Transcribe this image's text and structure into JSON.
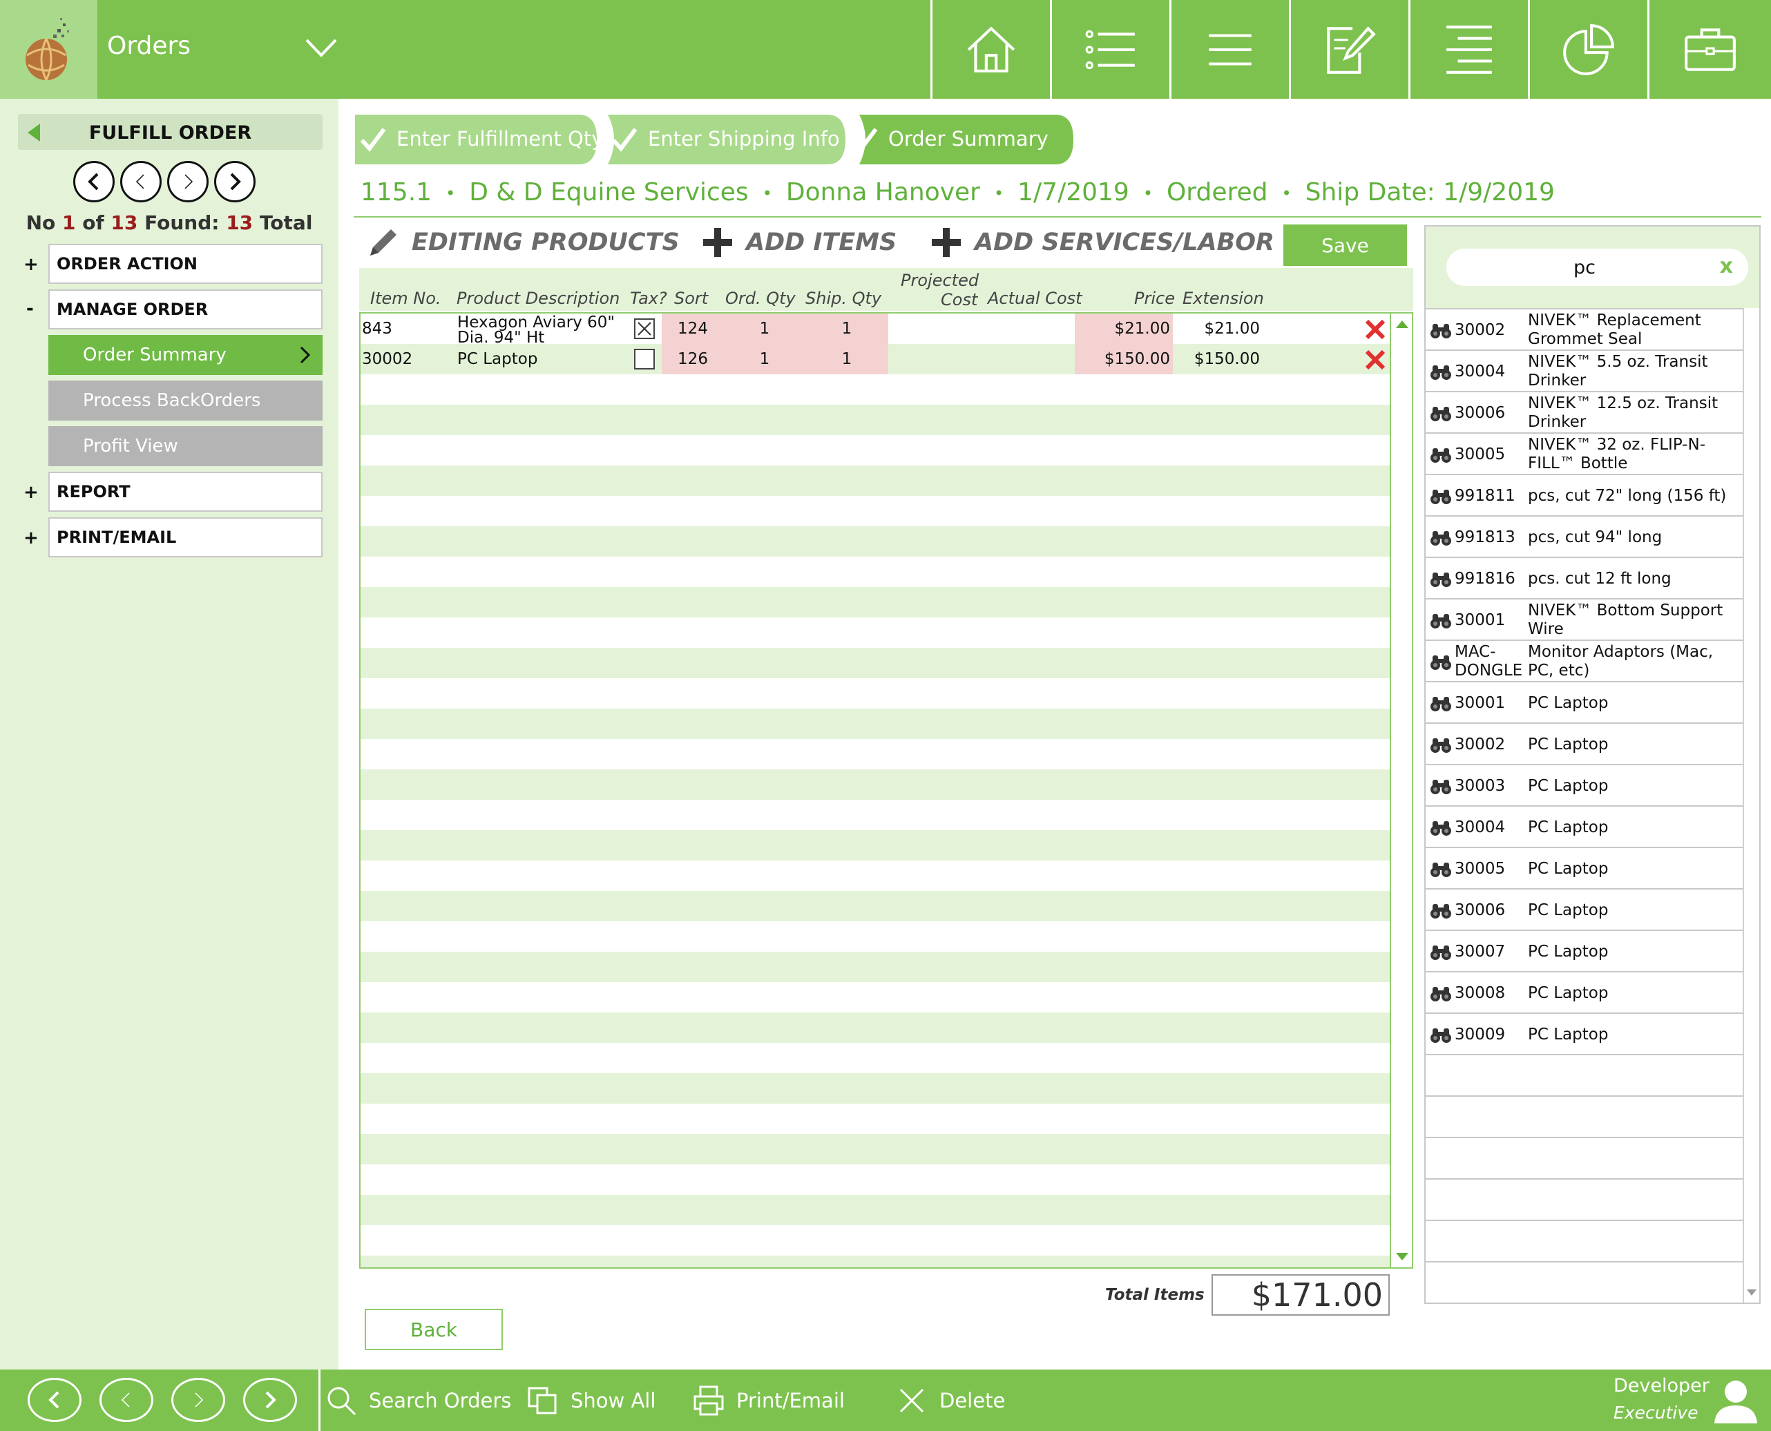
{
  "topbar": {
    "app_title": "Orders",
    "nav_icons": [
      "home-icon",
      "bullet-list-icon",
      "menu-lines-icon",
      "edit-document-icon",
      "align-lines-icon",
      "pie-chart-icon",
      "briefcase-icon"
    ]
  },
  "sidebar": {
    "header_title": "FULFILL ORDER",
    "found": {
      "prefix": "No",
      "current": "1",
      "of": "of",
      "total": "13",
      "found_label": "Found:",
      "found_count": "13",
      "total_label": "Total"
    },
    "sections": [
      {
        "sign": "+",
        "label": "ORDER ACTION"
      },
      {
        "sign": "-",
        "label": "MANAGE ORDER"
      },
      {
        "sign": "+",
        "label": "REPORT"
      },
      {
        "sign": "+",
        "label": "PRINT/EMAIL"
      }
    ],
    "subitems": [
      {
        "label": "Order Summary",
        "state": "active"
      },
      {
        "label": "Process BackOrders",
        "state": "disabled"
      },
      {
        "label": "Profit View",
        "state": "disabled"
      }
    ]
  },
  "steps": [
    {
      "label": "Enter Fulfillment Qty",
      "done": true
    },
    {
      "label": "Enter Shipping Info",
      "done": true
    },
    {
      "label": "Order Summary",
      "done": true,
      "current": true
    }
  ],
  "order": {
    "number": "115.1",
    "customer": "D & D Equine Services",
    "contact": "Donna Hanover",
    "date": "1/7/2019",
    "status": "Ordered",
    "ship_date": "Ship Date: 1/9/2019",
    "separator": "•"
  },
  "actions": {
    "editing": "EDITING PRODUCTS",
    "add_items": "ADD ITEMS",
    "add_services": "ADD SERVICES/LABOR",
    "save": "Save"
  },
  "columns": {
    "item_no": "Item No.",
    "description": "Product Description",
    "tax": "Tax?",
    "sort": "Sort",
    "ord_qty": "Ord. Qty",
    "ship_qty": "Ship. Qty",
    "projected_cost_1": "Projected",
    "projected_cost_2": "Cost",
    "actual_cost": "Actual Cost",
    "price": "Price",
    "extension": "Extension"
  },
  "line_items": [
    {
      "item_no": "843",
      "description": "Hexagon Aviary 60\" Dia. 94\" Ht",
      "taxable": true,
      "sort": "124",
      "ord_qty": "1",
      "ship_qty": "1",
      "projected_cost": "",
      "actual_cost": "",
      "price": "$21.00",
      "extension": "$21.00"
    },
    {
      "item_no": "30002",
      "description": "PC Laptop",
      "taxable": false,
      "sort": "126",
      "ord_qty": "1",
      "ship_qty": "1",
      "projected_cost": "",
      "actual_cost": "",
      "price": "$150.00",
      "extension": "$150.00"
    }
  ],
  "totals": {
    "label": "Total Items",
    "value": "$171.00"
  },
  "back_label": "Back",
  "search": {
    "value": "pc",
    "clear": "x",
    "results": [
      {
        "num": "30002",
        "desc": "NIVEK™ Replacement Grommet Seal"
      },
      {
        "num": "30004",
        "desc": "NIVEK™ 5.5 oz. Transit Drinker"
      },
      {
        "num": "30006",
        "desc": "NIVEK™ 12.5 oz. Transit Drinker"
      },
      {
        "num": "30005",
        "desc": "NIVEK™ 32 oz. FLIP-N-FILL™  Bottle"
      },
      {
        "num": "991811",
        "desc": "pcs, cut 72\" long  (156 ft)"
      },
      {
        "num": "991813",
        "desc": "pcs, cut 94\" long"
      },
      {
        "num": "991816",
        "desc": "pcs. cut 12 ft long"
      },
      {
        "num": "30001",
        "desc": "NIVEK™ Bottom Support Wire"
      },
      {
        "num": "MAC-DONGLE",
        "desc": "Monitor Adaptors (Mac, PC, etc)"
      },
      {
        "num": "30001",
        "desc": "PC Laptop"
      },
      {
        "num": "30002",
        "desc": "PC Laptop"
      },
      {
        "num": "30003",
        "desc": "PC Laptop"
      },
      {
        "num": "30004",
        "desc": "PC Laptop"
      },
      {
        "num": "30005",
        "desc": "PC Laptop"
      },
      {
        "num": "30006",
        "desc": "PC Laptop"
      },
      {
        "num": "30007",
        "desc": "PC Laptop"
      },
      {
        "num": "30008",
        "desc": "PC Laptop"
      },
      {
        "num": "30009",
        "desc": "PC Laptop"
      }
    ]
  },
  "bottombar": {
    "actions": [
      {
        "label": "Search Orders",
        "icon": "search-icon"
      },
      {
        "label": "Show All",
        "icon": "copy-icon"
      },
      {
        "label": "Print/Email",
        "icon": "printer-icon"
      },
      {
        "label": "Delete",
        "icon": "close-icon"
      }
    ],
    "user_name": "Developer",
    "user_role": "Executive"
  },
  "colors": {
    "brand_green": "#7dc24e",
    "light_green": "#e4f3d8",
    "pink_cell": "#f4d2d2",
    "delete_red": "#e03030"
  }
}
